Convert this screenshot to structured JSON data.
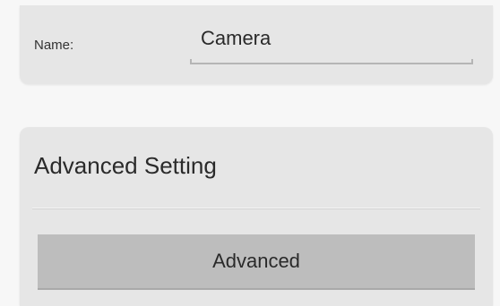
{
  "name_section": {
    "label": "Name:",
    "value": "Camera"
  },
  "advanced_section": {
    "title": "Advanced Setting",
    "button_label": "Advanced"
  }
}
